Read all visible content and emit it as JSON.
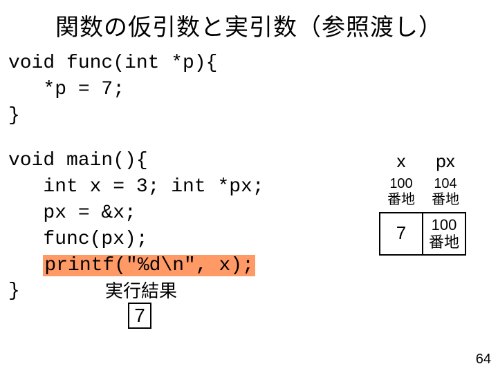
{
  "title": "関数の仮引数と実引数（参照渡し）",
  "code_func": "void func(int *p){\n   *p = 7;\n}",
  "code_main_pre": "void main(){\n   int x = 3; int *px;\n   px = &x;\n   func(px);\n   ",
  "printf_line": "printf(\"%d\\n\", x);",
  "code_main_post": "\n}",
  "result_label": "実行結果",
  "result_value": "7",
  "mem": {
    "h1": "x",
    "h2": "px",
    "a1_top": "100",
    "a1_bot": "番地",
    "a2_top": "104",
    "a2_bot": "番地",
    "v1": "7",
    "v2_top": "100",
    "v2_bot": "番地"
  },
  "page_number": "64"
}
